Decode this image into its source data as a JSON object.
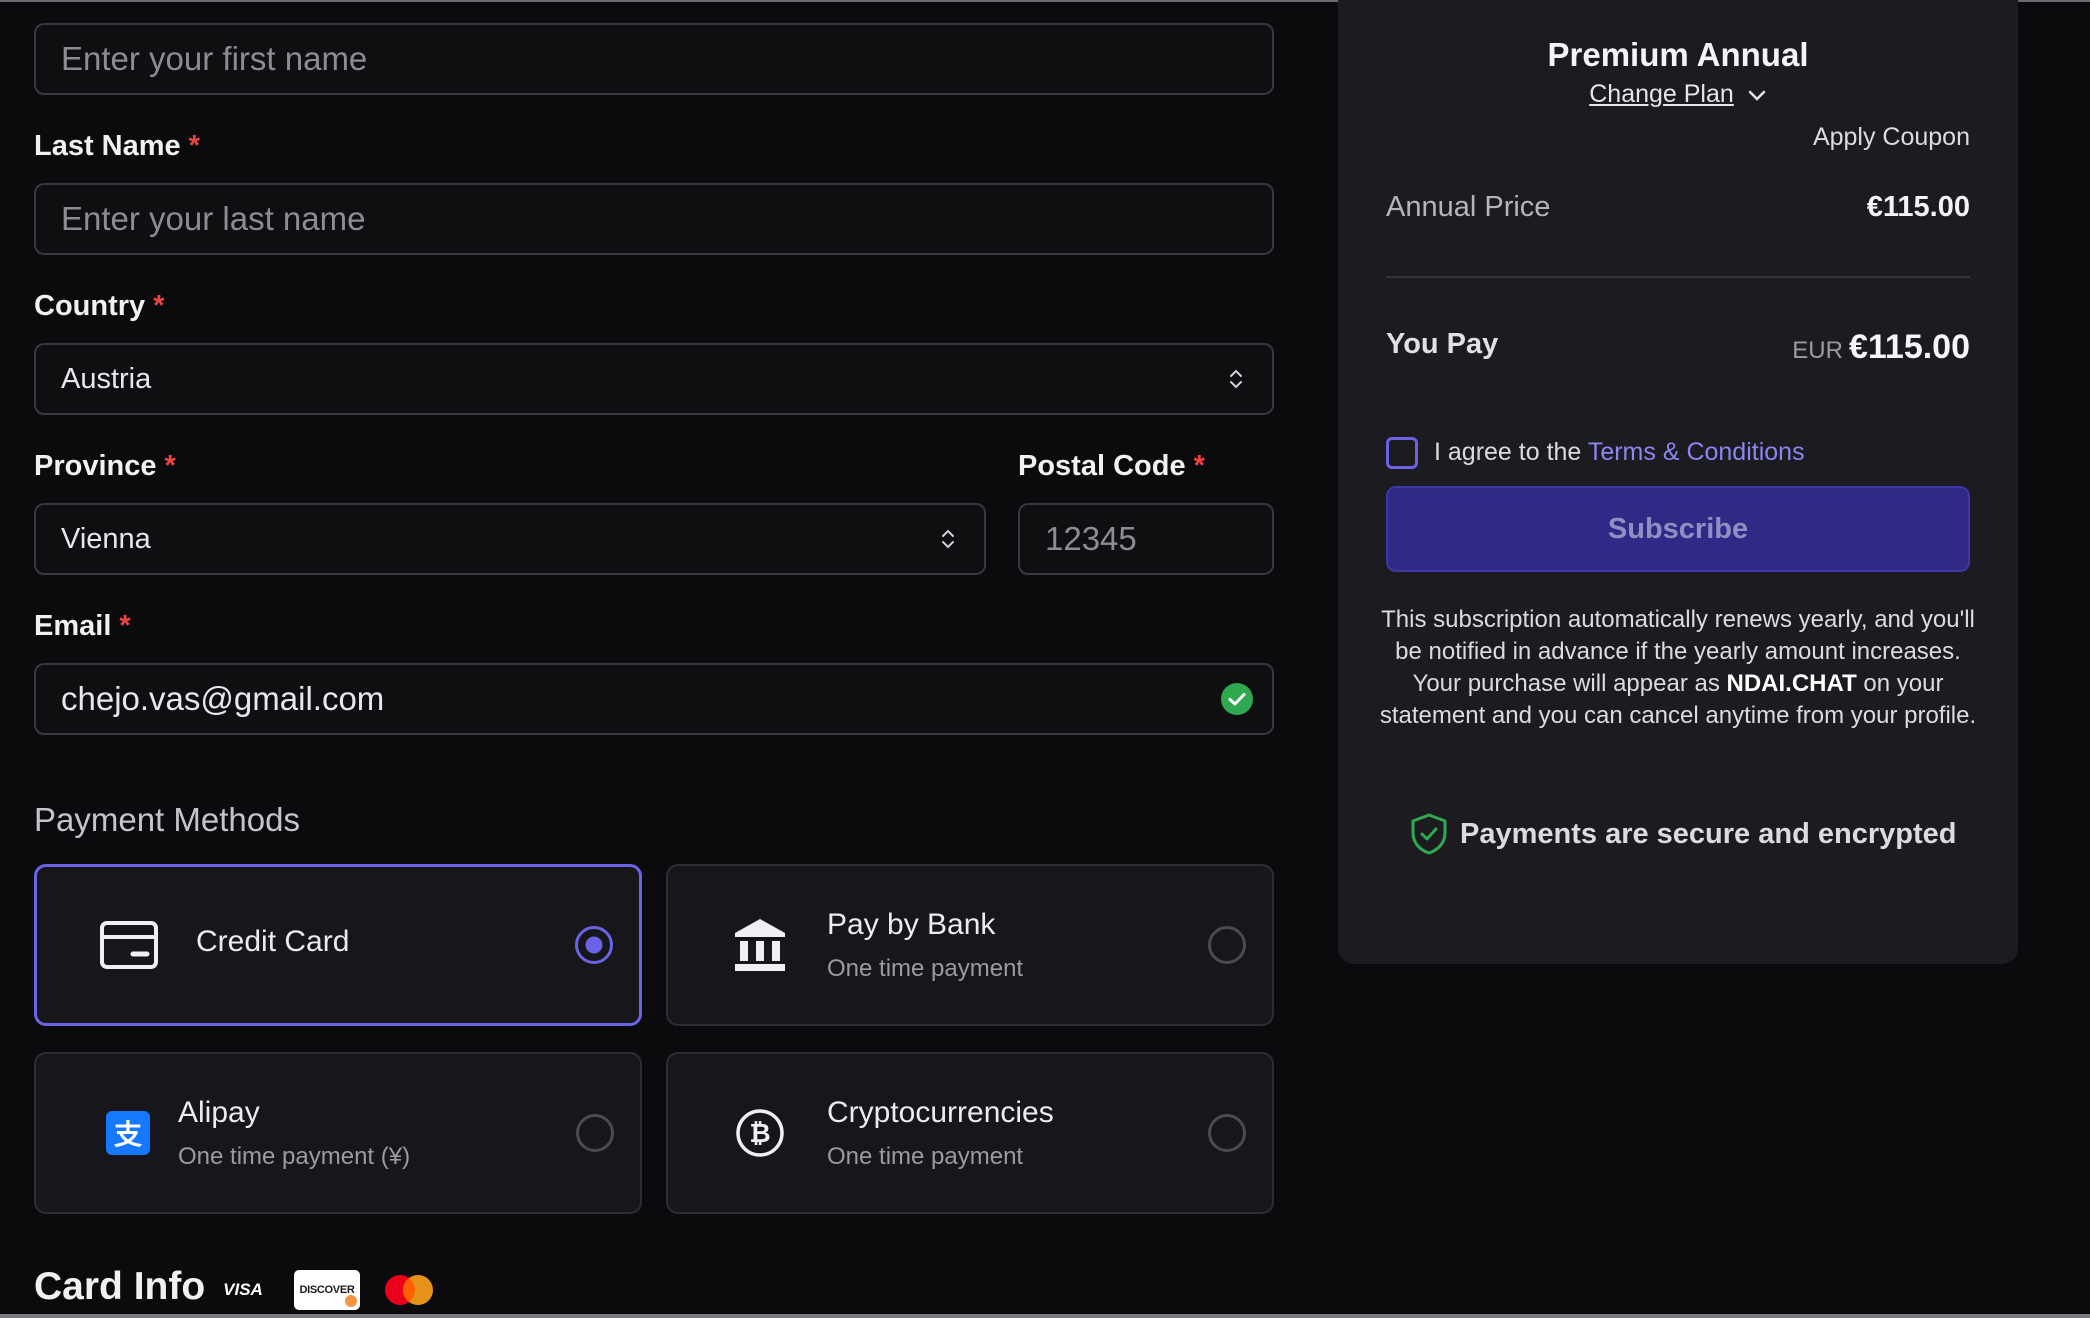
{
  "form": {
    "first_name_placeholder": "Enter your first name",
    "last_name": {
      "label": "Last Name",
      "required_mark": "*",
      "placeholder": "Enter your last name"
    },
    "country": {
      "label": "Country",
      "required_mark": "*",
      "value": "Austria"
    },
    "province": {
      "label": "Province",
      "required_mark": "*",
      "value": "Vienna"
    },
    "postal_code": {
      "label": "Postal Code",
      "required_mark": "*",
      "placeholder": "12345"
    },
    "email": {
      "label": "Email",
      "required_mark": "*",
      "value": "chejo.vas@gmail.com"
    }
  },
  "payment": {
    "section_title": "Payment Methods",
    "methods": [
      {
        "title": "Credit Card",
        "subtitle": "",
        "icon": "credit-card-icon",
        "selected": true
      },
      {
        "title": "Pay by Bank",
        "subtitle": "One time payment",
        "icon": "bank-icon",
        "selected": false
      },
      {
        "title": "Alipay",
        "subtitle": "One time payment (¥)",
        "icon": "alipay-icon",
        "selected": false
      },
      {
        "title": "Cryptocurrencies",
        "subtitle": "One time payment",
        "icon": "bitcoin-icon",
        "selected": false
      }
    ]
  },
  "card_info": {
    "title": "Card Info",
    "logos": [
      "VISA",
      "DISCOVER",
      "mastercard-icon"
    ]
  },
  "summary": {
    "plan_name": "Premium Annual",
    "change_plan": "Change Plan",
    "apply_coupon": "Apply Coupon",
    "annual_price_label": "Annual Price",
    "annual_price_value": "€115.00",
    "you_pay_label": "You Pay",
    "you_pay_currency": "EUR",
    "you_pay_amount": "€115.00",
    "agree_prefix": "I agree to the",
    "terms_link": "Terms & Conditions",
    "subscribe_label": "Subscribe",
    "disclaimer_before": "This subscription automatically renews yearly, and you'll be notified in advance if the yearly amount increases. Your purchase will appear as",
    "disclaimer_brand": "NDAI.CHAT",
    "disclaimer_after": "on your statement and you can cancel anytime from your profile.",
    "secure_text": "Payments are secure and encrypted"
  },
  "colors": {
    "accent": "#6b63e6",
    "required": "#ef4444",
    "success": "#2fa84f",
    "background": "#0b0b0d",
    "panel": "#1c1c20"
  }
}
